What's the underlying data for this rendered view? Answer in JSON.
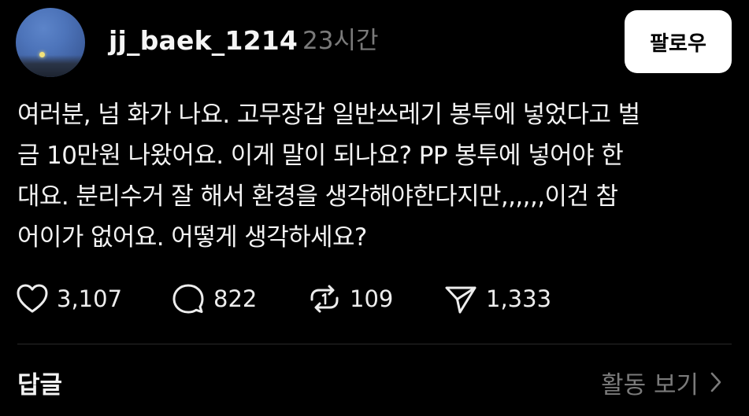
{
  "post": {
    "username": "jj_baek_1214",
    "time_ago": "23시간",
    "follow_label": "팔로우",
    "body_lines": [
      "여러분, 넘 화가 나요. 고무장갑 일반쓰레기 봉투에 넣었다고 벌",
      "금 10만원 나왔어요. 이게 말이 되나요? PP 봉투에 넣어야 한",
      "대요. 분리수거 잘 해서 환경을 생각해야한다지만,,,,,,이건 참",
      "어이가 없어요. 어떻게 생각하세요?"
    ],
    "actions": {
      "likes": "3,107",
      "comments": "822",
      "reposts": "109",
      "shares": "1,333"
    }
  },
  "footer": {
    "replies_label": "답글",
    "view_activity_label": "활동 보기"
  },
  "icons": {
    "like": "heart-icon",
    "comment": "comment-bubble-icon",
    "repost": "repost-icon",
    "share": "send-icon",
    "chevron": "chevron-right-icon"
  }
}
